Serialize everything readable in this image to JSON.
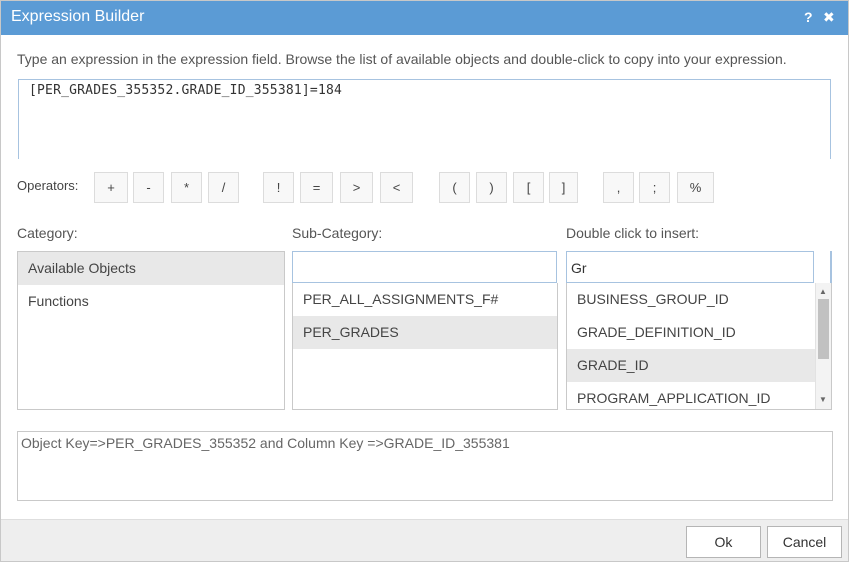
{
  "dialog": {
    "title": "Expression Builder",
    "help_icon": "?",
    "close_icon": "✖"
  },
  "instructions": "Type an expression in the expression field. Browse the list of available objects and double-click to copy into your expression.",
  "expression": "[PER_GRADES_355352.GRADE_ID_355381]=184",
  "operators": {
    "label": "Operators:",
    "items": [
      "+",
      "-",
      "*",
      "/",
      "!",
      "=",
      ">",
      "<",
      "(",
      ")",
      "[",
      "]",
      ",",
      ";",
      "%"
    ]
  },
  "category": {
    "label": "Category:",
    "items": [
      "Available Objects",
      "Functions"
    ],
    "selected": "Available Objects"
  },
  "subcategory": {
    "label": "Sub-Category:",
    "search_value": "",
    "items": [
      "PER_ALL_ASSIGNMENTS_F#",
      "PER_GRADES"
    ],
    "selected": "PER_GRADES"
  },
  "insert": {
    "label": "Double click to insert:",
    "search_value": "Gr",
    "items": [
      "BUSINESS_GROUP_ID",
      "GRADE_DEFINITION_ID",
      "GRADE_ID",
      "PROGRAM_APPLICATION_ID"
    ],
    "selected": "GRADE_ID",
    "scroll_up": "▲",
    "scroll_down": "▼"
  },
  "status": "Object Key=>PER_GRADES_355352 and Column Key =>GRADE_ID_355381",
  "buttons": {
    "ok": "Ok",
    "cancel": "Cancel"
  },
  "colors": {
    "titlebar": "#5b9bd5",
    "selected_row": "#e8e8e8"
  }
}
